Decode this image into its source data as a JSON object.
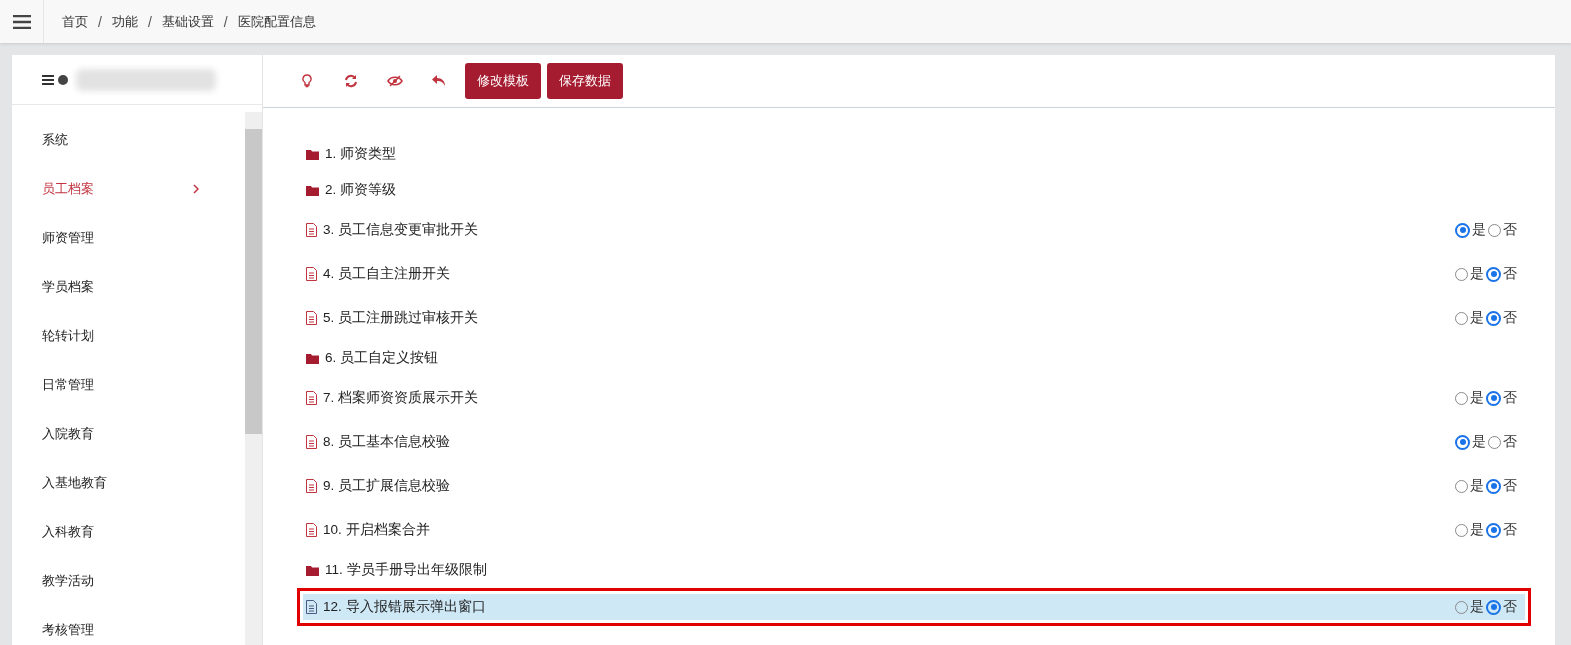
{
  "breadcrumb": [
    {
      "kind": "link",
      "text": "首页"
    },
    {
      "kind": "separator",
      "text": "/"
    },
    {
      "kind": "link",
      "text": "功能"
    },
    {
      "kind": "separator",
      "text": "/"
    },
    {
      "kind": "link",
      "text": "基础设置"
    },
    {
      "kind": "separator",
      "text": "/"
    },
    {
      "kind": "link",
      "text": "医院配置信息"
    }
  ],
  "sidebar": {
    "items": [
      {
        "label": "系统",
        "selected": false
      },
      {
        "label": "员工档案",
        "selected": true
      },
      {
        "label": "师资管理",
        "selected": false
      },
      {
        "label": "学员档案",
        "selected": false
      },
      {
        "label": "轮转计划",
        "selected": false
      },
      {
        "label": "日常管理",
        "selected": false
      },
      {
        "label": "入院教育",
        "selected": false
      },
      {
        "label": "入基地教育",
        "selected": false
      },
      {
        "label": "入科教育",
        "selected": false
      },
      {
        "label": "教学活动",
        "selected": false
      },
      {
        "label": "考核管理",
        "selected": false
      }
    ]
  },
  "toolbar": {
    "buttons": [
      "修改模板",
      "保存数据"
    ]
  },
  "rows": [
    {
      "kind": "folder",
      "label": "1. 师资类型",
      "selected": false
    },
    {
      "kind": "folder",
      "label": "2. 师资等级",
      "selected": false
    },
    {
      "kind": "setting",
      "label": "3. 员工信息变更审批开关",
      "selected": false,
      "options": [
        {
          "label": "是",
          "selected": true
        },
        {
          "label": "否",
          "selected": false
        }
      ]
    },
    {
      "kind": "setting",
      "label": "4. 员工自主注册开关",
      "selected": false,
      "options": [
        {
          "label": "是",
          "selected": false
        },
        {
          "label": "否",
          "selected": true
        }
      ]
    },
    {
      "kind": "setting",
      "label": "5. 员工注册跳过审核开关",
      "selected": false,
      "options": [
        {
          "label": "是",
          "selected": false
        },
        {
          "label": "否",
          "selected": true
        }
      ]
    },
    {
      "kind": "folder",
      "label": "6. 员工自定义按钮",
      "selected": false
    },
    {
      "kind": "setting",
      "label": "7. 档案师资资质展示开关",
      "selected": false,
      "options": [
        {
          "label": "是",
          "selected": false
        },
        {
          "label": "否",
          "selected": true
        }
      ]
    },
    {
      "kind": "setting",
      "label": "8. 员工基本信息校验",
      "selected": false,
      "options": [
        {
          "label": "是",
          "selected": true
        },
        {
          "label": "否",
          "selected": false
        }
      ]
    },
    {
      "kind": "setting",
      "label": "9. 员工扩展信息校验",
      "selected": false,
      "options": [
        {
          "label": "是",
          "selected": false
        },
        {
          "label": "否",
          "selected": true
        }
      ]
    },
    {
      "kind": "setting",
      "label": "10. 开启档案合并",
      "selected": false,
      "options": [
        {
          "label": "是",
          "selected": false
        },
        {
          "label": "否",
          "selected": true
        }
      ]
    },
    {
      "kind": "folder",
      "label": "11. 学员手册导出年级限制",
      "selected": false
    },
    {
      "kind": "setting",
      "label": "12. 导入报错展示弹出窗口",
      "selected": true,
      "options": [
        {
          "label": "是",
          "selected": false
        },
        {
          "label": "否",
          "selected": true
        }
      ]
    }
  ]
}
